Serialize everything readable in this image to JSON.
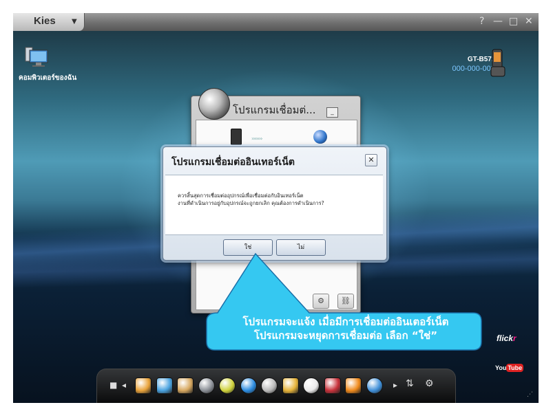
{
  "window": {
    "app_name": "Kies",
    "app_menu_arrow": "▼",
    "controls": {
      "help": "?",
      "minimize": "—",
      "maximize": "□",
      "close": "✕"
    }
  },
  "desktop": {
    "pc_label": "คอมพิวเตอร์ของฉัน",
    "device_model": "GT-B5722",
    "device_number": "000-000-0000"
  },
  "back_dialog": {
    "title": "โปรแกรมเชื่อมต่...",
    "minimize": "_",
    "close": "✕",
    "arrows": "›››››››"
  },
  "dialog": {
    "title": "โปรแกรมเชื่อมต่ออินเทอร์เน็ต",
    "close": "✕",
    "message_line1": "ควรสิ้นสุดการเชื่อมต่ออุปกรณ์เพื่อเชื่อมต่อกับอินเทอร์เน็ต",
    "message_line2": "งานที่ดำเนินการอยู่กับอุปกรณ์จะถูกยกเลิก คุณต้องการดำเนินการ?",
    "yes_label": "ใช่",
    "no_label": "ไม่"
  },
  "callout": {
    "line1": "โปรแกรมจะแจ้ง เมื่อมีการเชื่อมต่ออินเตอร์เน็ต",
    "line2": "โปรแกรมจะหยุดการเชื่อมต่อ เลือก “ใช่”"
  },
  "sidebar_links": {
    "flickr_a": "flick",
    "flickr_b": "r",
    "youtube_a": "You",
    "youtube_b": "Tube"
  },
  "dock": {
    "stop": "■",
    "prev": "◂",
    "next": "▸",
    "sync": "⇅",
    "settings": "⚙",
    "icons": [
      "notes-icon",
      "photo-gallery-icon",
      "photo-edit-icon",
      "video-reel-icon",
      "app-ball-icon",
      "media-player-icon",
      "film-icon",
      "picture-icon",
      "disc-icon",
      "store-icon",
      "vlc-cone-icon",
      "globe-icon"
    ],
    "icon_colors": [
      "#e9a33b",
      "#4aa3e0",
      "#d7a860",
      "#8a8f96",
      "#cfd23c",
      "#2b8be0",
      "#b9b9b9",
      "#e7b43a",
      "#eaeaea",
      "#c8323b",
      "#f08a1c",
      "#3f8fd8"
    ]
  },
  "colors": {
    "dialog_border": "#6d7f95",
    "callout_fill": "#35c8f1",
    "callout_stroke": "#1a6fa8",
    "device_number": "#7cc6ff"
  }
}
